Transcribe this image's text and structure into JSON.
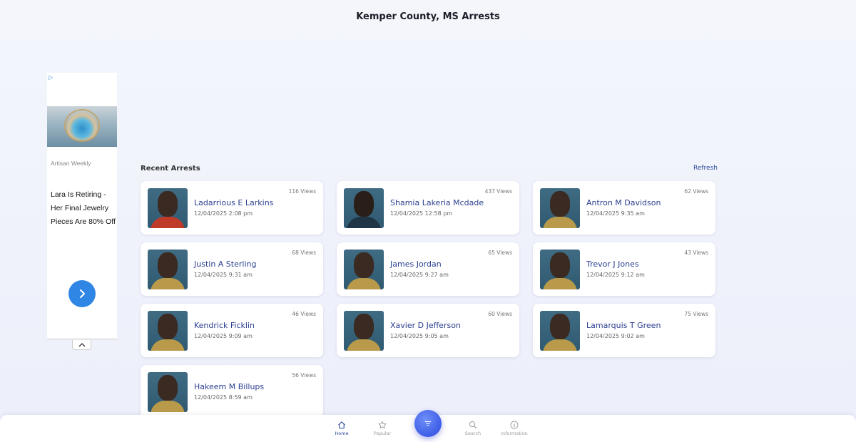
{
  "header": {
    "title": "Kemper County, MS Arrests"
  },
  "ad": {
    "brand": "Artisan Weekly",
    "headline": "Lara Is Retiring - Her Final Jewelry Pieces Are 80% Off"
  },
  "section": {
    "title": "Recent Arrests",
    "refresh_label": "Refresh"
  },
  "arrests": [
    {
      "name": "Ladarrious E Larkins",
      "date": "12/04/2025 2:08 pm",
      "views": "116 Views"
    },
    {
      "name": "Shamia Lakeria Mcdade",
      "date": "12/04/2025 12:58 pm",
      "views": "437 Views"
    },
    {
      "name": "Antron M Davidson",
      "date": "12/04/2025 9:35 am",
      "views": "62 Views"
    },
    {
      "name": "Justin A Sterling",
      "date": "12/04/2025 9:31 am",
      "views": "68 Views"
    },
    {
      "name": "James Jordan",
      "date": "12/04/2025 9:27 am",
      "views": "65 Views"
    },
    {
      "name": "Trevor J Jones",
      "date": "12/04/2025 9:12 am",
      "views": "43 Views"
    },
    {
      "name": "Kendrick Ficklin",
      "date": "12/04/2025 9:09 am",
      "views": "46 Views"
    },
    {
      "name": "Xavier D Jefferson",
      "date": "12/04/2025 9:05 am",
      "views": "60 Views"
    },
    {
      "name": "Lamarquis T Green",
      "date": "12/04/2025 9:02 am",
      "views": "75 Views"
    },
    {
      "name": "Hakeem M Billups",
      "date": "12/04/2025 8:59 am",
      "views": "56 Views"
    }
  ],
  "nav": {
    "home": "Home",
    "popular": "Popular",
    "search": "Search",
    "information": "Information"
  },
  "colors": {
    "accent": "#2b4a9a",
    "fab": "#3d5de8",
    "ad_cta": "#2f86e4"
  }
}
